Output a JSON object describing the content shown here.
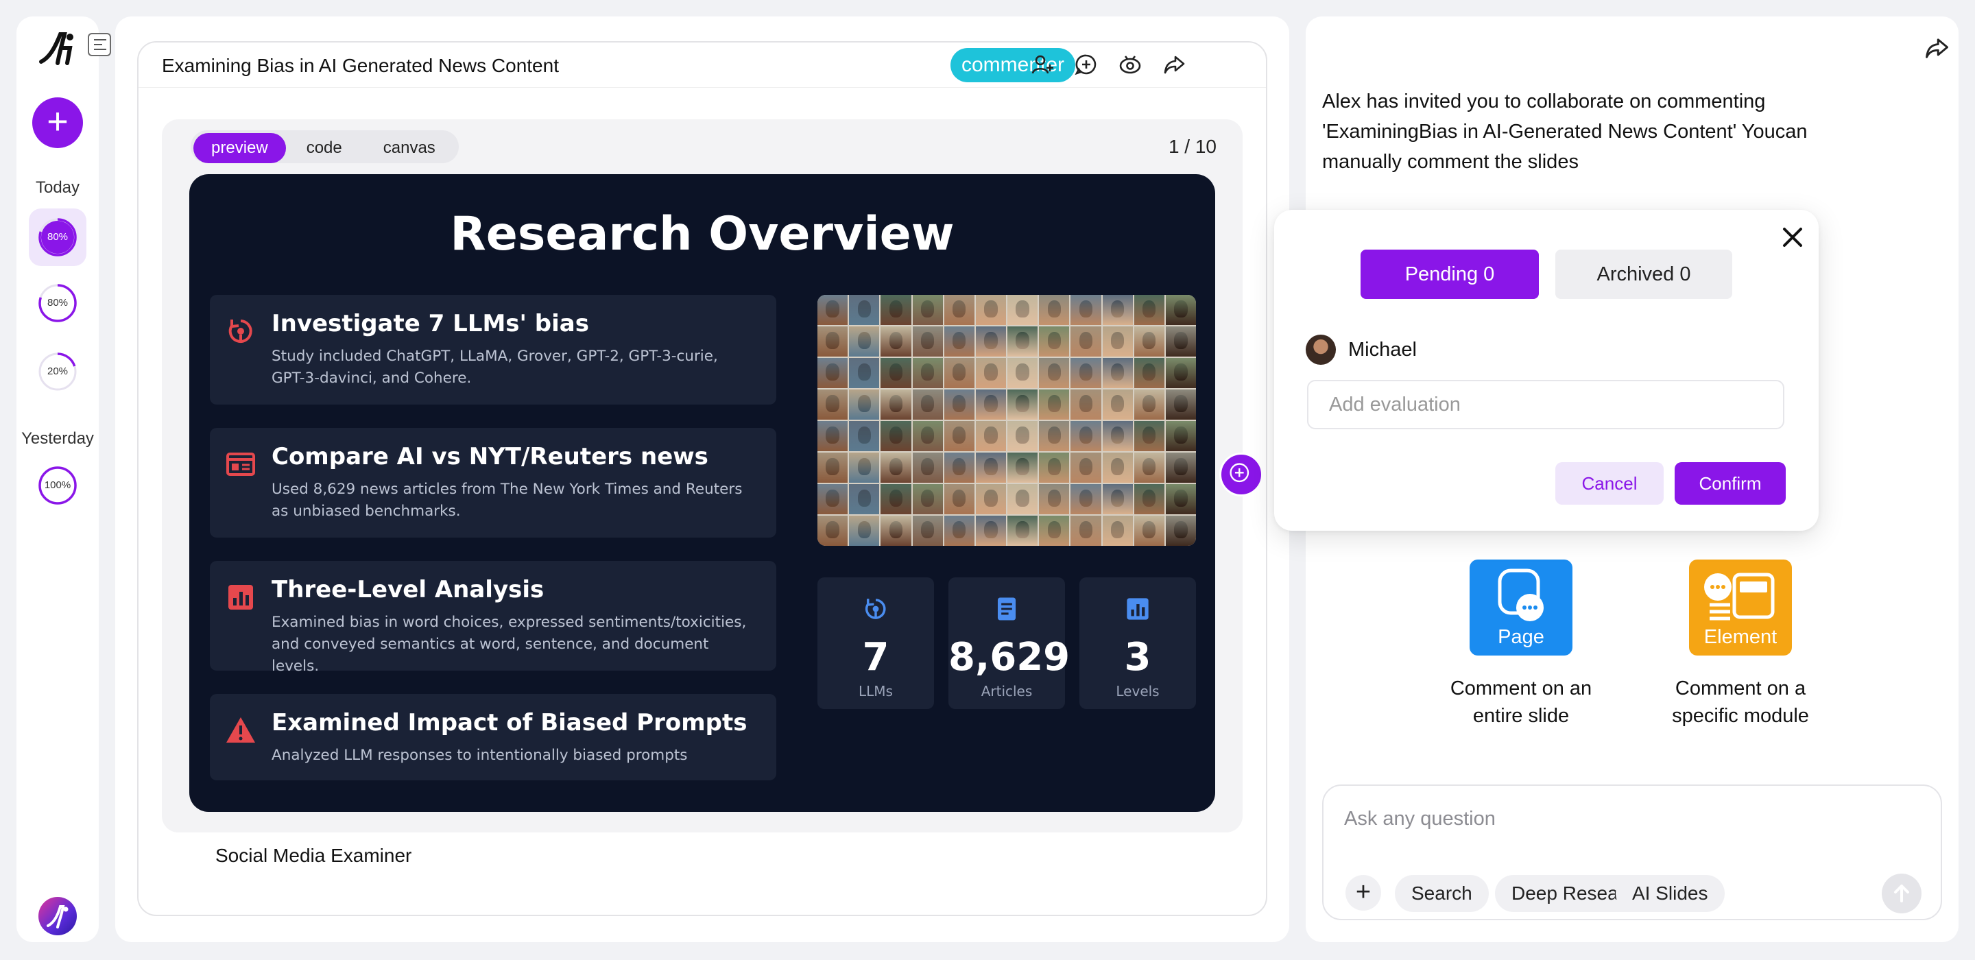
{
  "rail": {
    "today_label": "Today",
    "yesterday_label": "Yesterday",
    "today_items": [
      {
        "progress_label": "80%",
        "progress": 0.8,
        "active": true
      },
      {
        "progress_label": "80%",
        "progress": 0.8,
        "active": false
      },
      {
        "progress_label": "20%",
        "progress": 0.2,
        "active": false
      }
    ],
    "yesterday_items": [
      {
        "progress_label": "100%",
        "progress": 1.0,
        "active": false
      }
    ],
    "accent": "#8a16e8"
  },
  "document": {
    "title": "Examining Bias in AI Generated News Content",
    "role": "commenter",
    "view_tabs": [
      "preview",
      "code",
      "canvas"
    ],
    "active_tab": "preview",
    "page_indicator": "1 / 10",
    "caption": "Social Media Examiner",
    "icons": [
      "add-user-icon",
      "add-comment-icon",
      "view-icon",
      "share-icon"
    ]
  },
  "slide": {
    "title": "Research Overview",
    "cards": [
      {
        "icon": "rotate-icon",
        "title": "Investigate 7 LLMs' bias",
        "desc": "Study included ChatGPT, LLaMA, Grover, GPT-2, GPT-3-curie, GPT-3-davinci, and Cohere."
      },
      {
        "icon": "newspaper-icon",
        "title": "Compare AI vs NYT/Reuters news",
        "desc": "Used 8,629 news articles from The New York Times and Reuters as unbiased benchmarks."
      },
      {
        "icon": "chart-icon",
        "title": "Three-Level Analysis",
        "desc": "Examined bias in word choices, expressed sentiments/toxicities, and conveyed semantics at word, sentence, and document levels."
      },
      {
        "icon": "warning-icon",
        "title": "Examined Impact of Biased Prompts",
        "desc": "Analyzed LLM responses to intentionally biased prompts"
      }
    ],
    "stats": [
      {
        "icon": "rotate-icon",
        "value": "7",
        "label": "LLMs"
      },
      {
        "icon": "document-icon",
        "value": "8,629",
        "label": "Articles"
      },
      {
        "icon": "chart-icon",
        "value": "3",
        "label": "Levels"
      }
    ],
    "colors": {
      "background": "#0c1326",
      "card": "#1a2236",
      "card_icon": "#e5484d",
      "stat_icon": "#4a8df0"
    }
  },
  "right_panel": {
    "invite_text": "Alex has invited you to collaborate on commenting 'ExaminingBias in AI-Generated News Content' Youcan manually comment the slides",
    "features": [
      {
        "icon": "page-comment-icon",
        "label": "Page",
        "desc": "Comment on an entire slide",
        "color": "#1a8cf0"
      },
      {
        "icon": "element-comment-icon",
        "label": "Element",
        "desc": "Comment on a specific module",
        "color": "#f5a514"
      }
    ],
    "ask": {
      "placeholder": "Ask any question",
      "chips": [
        "Search",
        "Deep Research",
        "AI Slides"
      ]
    }
  },
  "popup": {
    "pending_label": "Pending 0",
    "archived_label": "Archived 0",
    "user_name": "Michael",
    "input_placeholder": "Add evaluation",
    "cancel_label": "Cancel",
    "confirm_label": "Confirm"
  }
}
